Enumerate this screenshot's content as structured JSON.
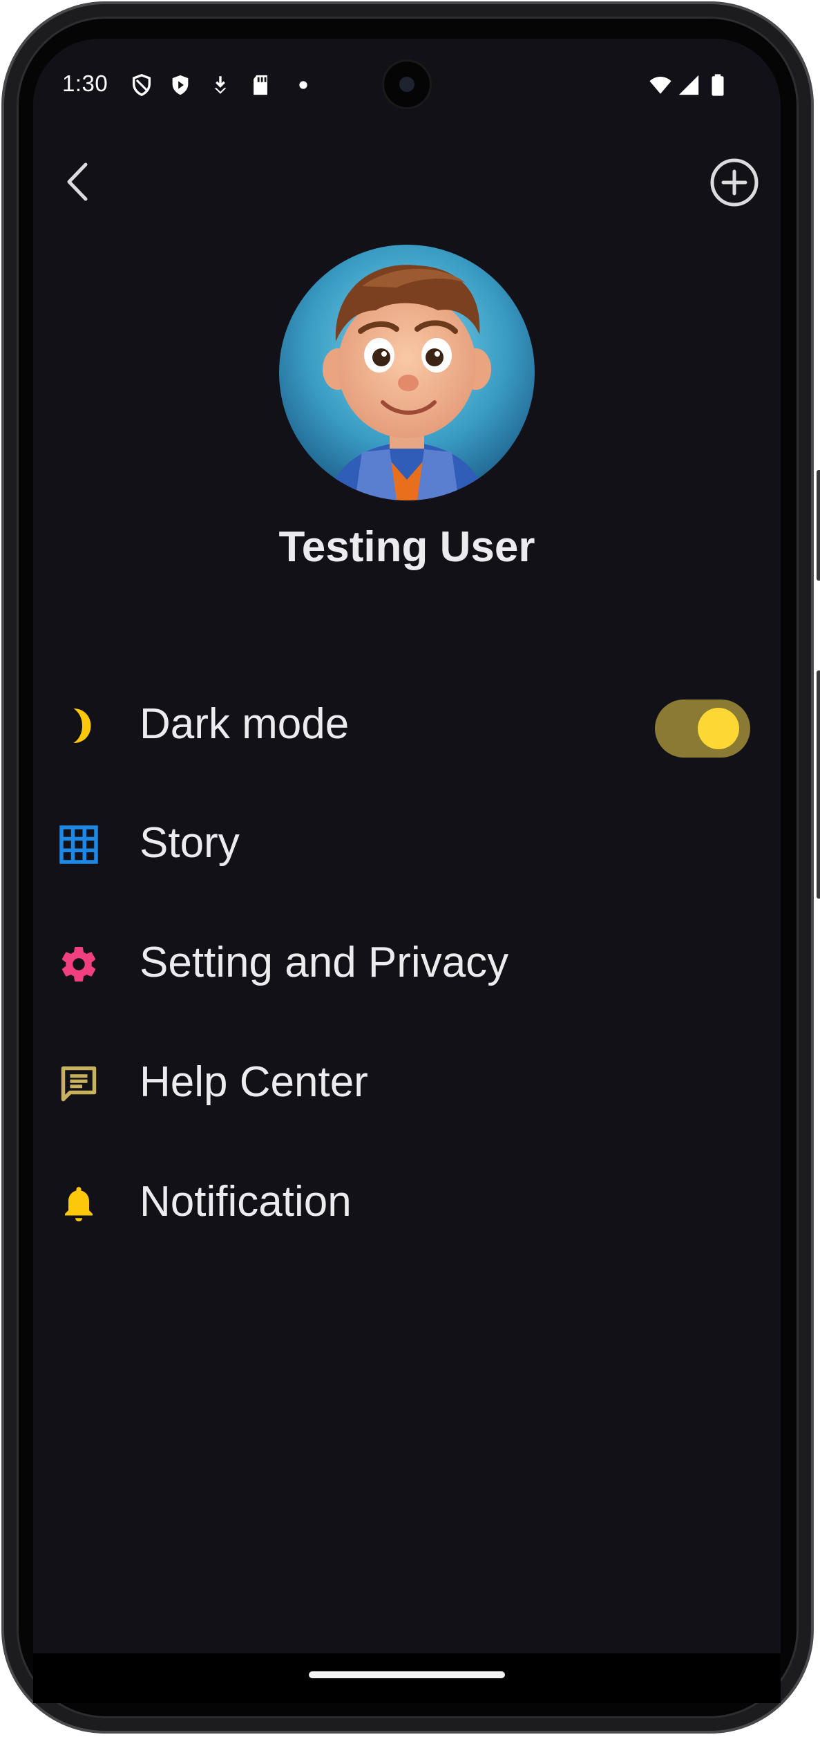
{
  "status_bar": {
    "time": "1:30",
    "icons": [
      "shield-outline-icon",
      "shield-play-icon",
      "download-icon",
      "sd-card-icon",
      "dot-icon",
      "wifi-icon",
      "signal-icon",
      "battery-icon"
    ]
  },
  "top_bar": {
    "back_icon": "chevron-left-icon",
    "add_icon": "add-circle-icon"
  },
  "profile": {
    "name": "Testing User",
    "avatar": "cartoon-boy-avatar"
  },
  "menu": {
    "items": [
      {
        "label": "Dark mode",
        "icon": "moon-icon",
        "icon_color": "#FDC70A",
        "toggle": true,
        "toggle_on": true
      },
      {
        "label": "Story",
        "icon": "grid-icon",
        "icon_color": "#1E88E5"
      },
      {
        "label": "Setting and Privacy",
        "icon": "gear-icon",
        "icon_color": "#F0407F"
      },
      {
        "label": "Help Center",
        "icon": "message-icon",
        "icon_color": "#C7B25E"
      },
      {
        "label": "Notification",
        "icon": "bell-icon",
        "icon_color": "#FDC70A"
      }
    ]
  },
  "colors": {
    "background": "#131118",
    "text": "#ECEBF0",
    "toggle_track": "#8A7A34",
    "toggle_knob": "#FDD835"
  }
}
